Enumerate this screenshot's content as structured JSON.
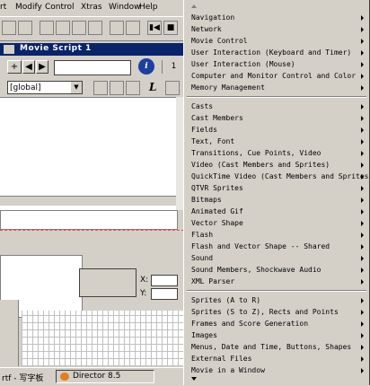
{
  "menubar": {
    "items": [
      "rt",
      "Modify",
      "Control",
      "Xtras",
      "Window",
      "Help"
    ]
  },
  "toolbar": {
    "stop_label": "■",
    "play_label": "▶"
  },
  "script_window": {
    "title": "Movie Script 1",
    "add_label": "+",
    "prev_label": "◀",
    "next_label": "▶",
    "info_label": "i",
    "number_value": "1",
    "scope_value": "[global]",
    "l_label": "L"
  },
  "lower_panel": {
    "x_label": "X:",
    "y_label": "Y:"
  },
  "taskbar": {
    "ime_label": "rtf - 写字板",
    "app_label": "Director 8.5"
  },
  "context_menu": {
    "groups": [
      [
        "Navigation",
        "Network",
        "Movie Control",
        "User Interaction (Keyboard and Timer)",
        "User Interaction (Mouse)",
        "Computer and Monitor Control and Color",
        "Memory Management"
      ],
      [
        "Casts",
        "Cast Members",
        "Fields",
        "Text, Font",
        "Transitions, Cue Points, Video",
        "Video (Cast Members and Sprites)",
        "QuickTime Video (Cast Members and Sprites)",
        "QTVR Sprites",
        "Bitmaps",
        "Animated Gif",
        "Vector Shape",
        "Flash",
        "Flash and Vector Shape -- Shared",
        "Sound",
        "Sound Members, Shockwave Audio",
        "XML Parser"
      ],
      [
        "Sprites (A to R)",
        "Sprites (S to Z), Rects and Points",
        "Frames and Score Generation",
        "Images",
        "Menus, Date and Time, Buttons, Shapes",
        "External Files",
        "Movie in a Window"
      ]
    ]
  }
}
